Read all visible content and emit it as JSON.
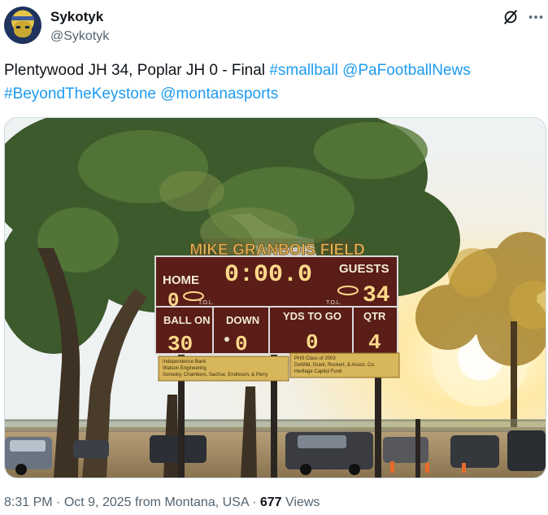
{
  "author": {
    "display_name": "Sykotyk",
    "handle": "@Sykotyk",
    "avatar_icon": "helmet-avatar"
  },
  "tweet": {
    "text_plain": "Plentywood JH 34, Poplar JH 0 - Final ",
    "tags": [
      "#smallball",
      "@PaFootballNews",
      "#BeyondTheKeystone",
      "@montanasports"
    ]
  },
  "photo": {
    "field_sign": "MIKE GRANBOIS FIELD",
    "scoreboard": {
      "home_label": "HOME",
      "guests_label": "GUESTS",
      "home_score": "0",
      "guests_score": "34",
      "clock": "0:00.0",
      "tol_left": "T.O.L.",
      "tol_right": "T.O.L.",
      "ball_on_label": "BALL ON",
      "down_label": "DOWN",
      "yds_to_go_label": "YDS TO GO",
      "qtr_label": "QTR",
      "ball_on": "30",
      "down": "0",
      "yds_to_go": "0",
      "qtr": "4"
    },
    "sponsor_left": [
      "Independence Bank",
      "Watson Engineering",
      "Sonosky, Chambers, Sachse, Endreson, & Perry"
    ],
    "sponsor_right": [
      "PHS Class of 2003",
      "DeWild, Grant, Rockert, & Assoc. Co.",
      "Heritage Capitol Fund"
    ]
  },
  "meta": {
    "time": "8:31 PM",
    "date": "Oct 9, 2025",
    "location": "from Montana, USA",
    "views_count": "677",
    "views_label": "Views"
  },
  "colors": {
    "link": "#1d9bf0",
    "text": "#0f1419",
    "muted": "#536471"
  }
}
